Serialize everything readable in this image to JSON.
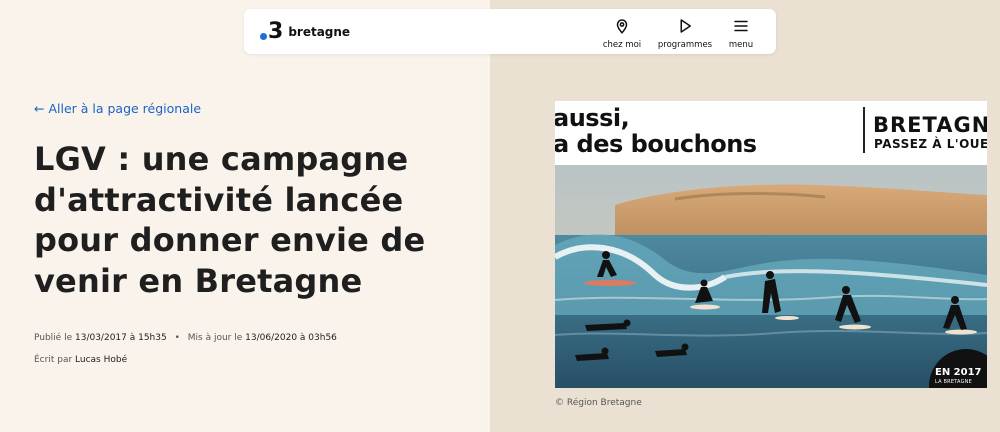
{
  "header": {
    "logo_number": "3",
    "logo_name": "bretagne",
    "nav": [
      {
        "label": "chez moi",
        "icon": "location-pin-icon"
      },
      {
        "label": "programmes",
        "icon": "play-icon"
      },
      {
        "label": "menu",
        "icon": "hamburger-menu-icon"
      }
    ]
  },
  "article": {
    "back_link": "← Aller à la page régionale",
    "title": "LGV : une campagne d'attractivité lancée pour donner envie de venir en Bretagne",
    "published_label": "Publié le",
    "published_value": "13/03/2017 à 15h35",
    "separator": "•",
    "updated_label": "Mis à jour le",
    "updated_value": "13/06/2020 à 03h56",
    "author_label": "Écrit par",
    "author_value": "Lucas Hobé"
  },
  "image": {
    "banner_line1": "aussi,",
    "banner_line2": "a des bouchons",
    "banner_brand": "BRETAGN",
    "banner_tagline": "PASSEZ À L'OUE",
    "badge_year": "EN 2017",
    "badge_sub": "LA BRETAGNE",
    "credit": "© Région Bretagne"
  },
  "colors": {
    "link": "#1a64c6",
    "logo_dot": "#1a6fd6",
    "page_bg": "#f9f3ec"
  }
}
